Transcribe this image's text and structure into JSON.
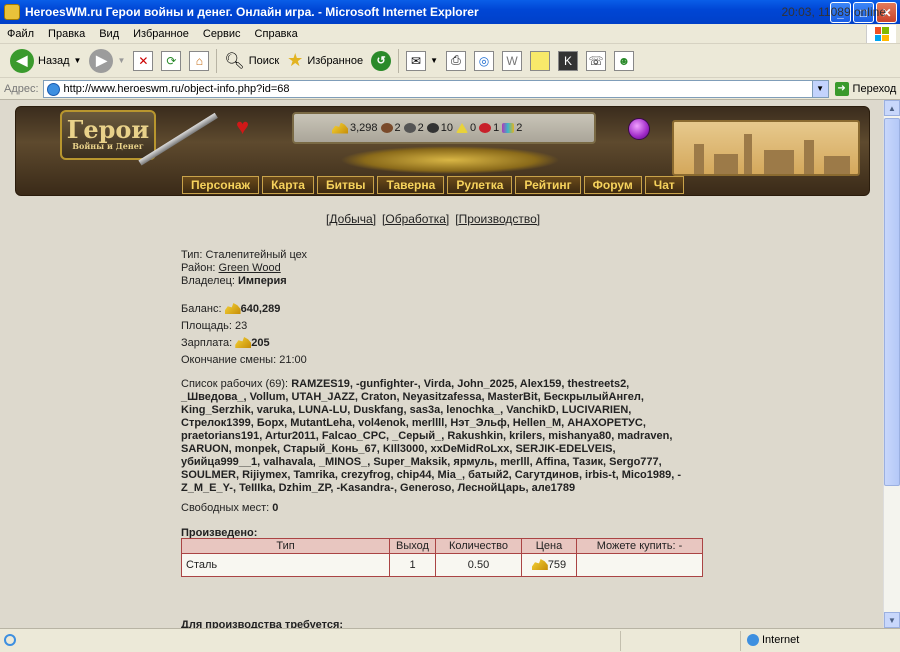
{
  "window": {
    "title": "HeroesWM.ru Герои войны и денег. Онлайн игра. - Microsoft Internet Explorer",
    "min_label": "_",
    "max_label": "□",
    "close_label": "✕"
  },
  "menubar": {
    "items": [
      "Файл",
      "Правка",
      "Вид",
      "Избранное",
      "Сервис",
      "Справка"
    ]
  },
  "toolbar": {
    "back_label": "Назад",
    "search_label": "Поиск",
    "favorites_label": "Избранное"
  },
  "address": {
    "label": "Адрес:",
    "url": "http://www.heroeswm.ru/object-info.php?id=68",
    "go_label": "Переход"
  },
  "header": {
    "online": "20:03, 11089 online",
    "logo_text": "Герои",
    "logo_sub": "Войны и Денег",
    "resources": [
      {
        "icon": "gold-icon",
        "value": "3,298",
        "color": "#e2b320"
      },
      {
        "icon": "wood-icon",
        "value": "2",
        "color": "#7a4a2a"
      },
      {
        "icon": "ore-icon",
        "value": "2",
        "color": "#555555"
      },
      {
        "icon": "mercury-icon",
        "value": "10",
        "color": "#333333"
      },
      {
        "icon": "sulfur-icon",
        "value": "0",
        "color": "#e8d23a"
      },
      {
        "icon": "crystal-icon",
        "value": "1",
        "color": "#c8202a"
      },
      {
        "icon": "gems-icon",
        "value": "2",
        "color": "#b03ab8"
      }
    ]
  },
  "nav": [
    "Персонаж",
    "Карта",
    "Битвы",
    "Таверна",
    "Рулетка",
    "Рейтинг",
    "Форум",
    "Чат"
  ],
  "links": {
    "mining": "[Добыча]",
    "processing": "[Обработка]",
    "production": "[Производство]"
  },
  "info": {
    "type_label": "Тип:",
    "type_value": "Сталепитейный цех",
    "district_label": "Район:",
    "district_value": "Green Wood",
    "owner_label": "Владелец:",
    "owner_value": "Империя",
    "balance_label": "Баланс:",
    "balance_value": "640,289",
    "area_label": "Площадь:",
    "area_value": "23",
    "salary_label": "Зарплата:",
    "salary_value": "205",
    "shift_label": "Окончание смены:",
    "shift_value": "21:00"
  },
  "workers": {
    "label": "Список рабочих (69):",
    "names": "RAMZES19, -gunfighter-, Virda, John_2025, Alex159, thestreets2, _Шведова_, Vollum, UTAH_JAZZ, Craton, Neyasitzafessa, MasterBit, БескрылыйАнгел, King_Serzhik, varuka, LUNA-LU, Duskfang, sas3a, lenochka_, VanchikD, LUCIVARIEN, Стрелок1399, Борх, MutantLeha, vol4enok, merllll, Нэт_Эльф, Hellen_M, АНАХОРЕТУС, praetorians191, Artur2011, Falcao_CPC, _Серый_, Rakushkin, krilers, mishanya80, madraven, SARUON, monpek, Старый_Конь_67, KIll3000, xxDeMidRoLxx, SERJIK-EDELVEIS, убийца999__1, valhavala, _MINOS_, Super_Maksik, ярмуль, merlll, Affina, Тазик, Sergo777, SOULMER, Rijiymex, Tamrika, crezyfrog, chip44, Mia_, батый2, Сагутдинов, irbis-t, Mico1989, -Z_M_E_Y-, TeIIIka, Dzhim_ZP, -Kasandra-, Generoso, ЛеснойЦарь, але1789",
    "free_label": "Свободных мест:",
    "free_value": "0"
  },
  "production": {
    "heading": "Произведено:",
    "columns": [
      "Тип",
      "Выход",
      "Количество",
      "Цена",
      "Можете купить: -"
    ],
    "rows": [
      {
        "type": "Сталь",
        "output": "1",
        "quantity": "0.50",
        "price": "759",
        "buy": ""
      }
    ],
    "requires_heading": "Для производства требуется:"
  },
  "status": {
    "zone": "Internet"
  }
}
